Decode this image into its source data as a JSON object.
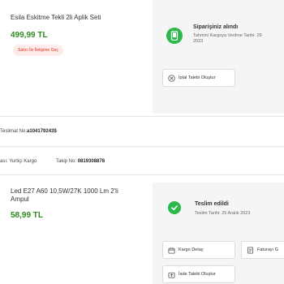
{
  "order1": {
    "product_name": "Esila Eskitme Tekli 2li Aplik Seti",
    "price": "499,99 TL",
    "seller_contact_label": "Satıcı İle İletişime Geç",
    "status": {
      "title": "Siparişiniz alındı",
      "subtitle_line1": "Tahmini Kargoya Verilme Tarihi: 29",
      "subtitle_line2": "2023",
      "icon": "phone-icon"
    },
    "cancel_label": "İptal Talebi Oluştur"
  },
  "delivery_no": {
    "label": "Teslimat No:",
    "value": "a104179243$"
  },
  "shipment": {
    "carrier_label": "ası: Yurtiçi Kargo",
    "tracking_label": "Takip No:",
    "tracking_value": "0819308878"
  },
  "order2": {
    "product_name_line1": "Led E27 A60 10,5W/27K 1000 Lm 2'li",
    "product_name_line2": "Ampul",
    "price": "58,99 TL",
    "status": {
      "title": "Teslim edildi",
      "subtitle": "Teslim Tarihi: 25 Aralık 2023",
      "icon": "check-icon"
    },
    "buttons": {
      "cargo_detail": "Kargo Detay",
      "invoice": "Faturayı G",
      "return": "İade Talebi Oluştur"
    }
  },
  "colors": {
    "accent_green": "#2db84b",
    "price_green": "#2e8b1e",
    "seller_red": "#e0301e",
    "panel_bg": "#f5f5f5"
  }
}
